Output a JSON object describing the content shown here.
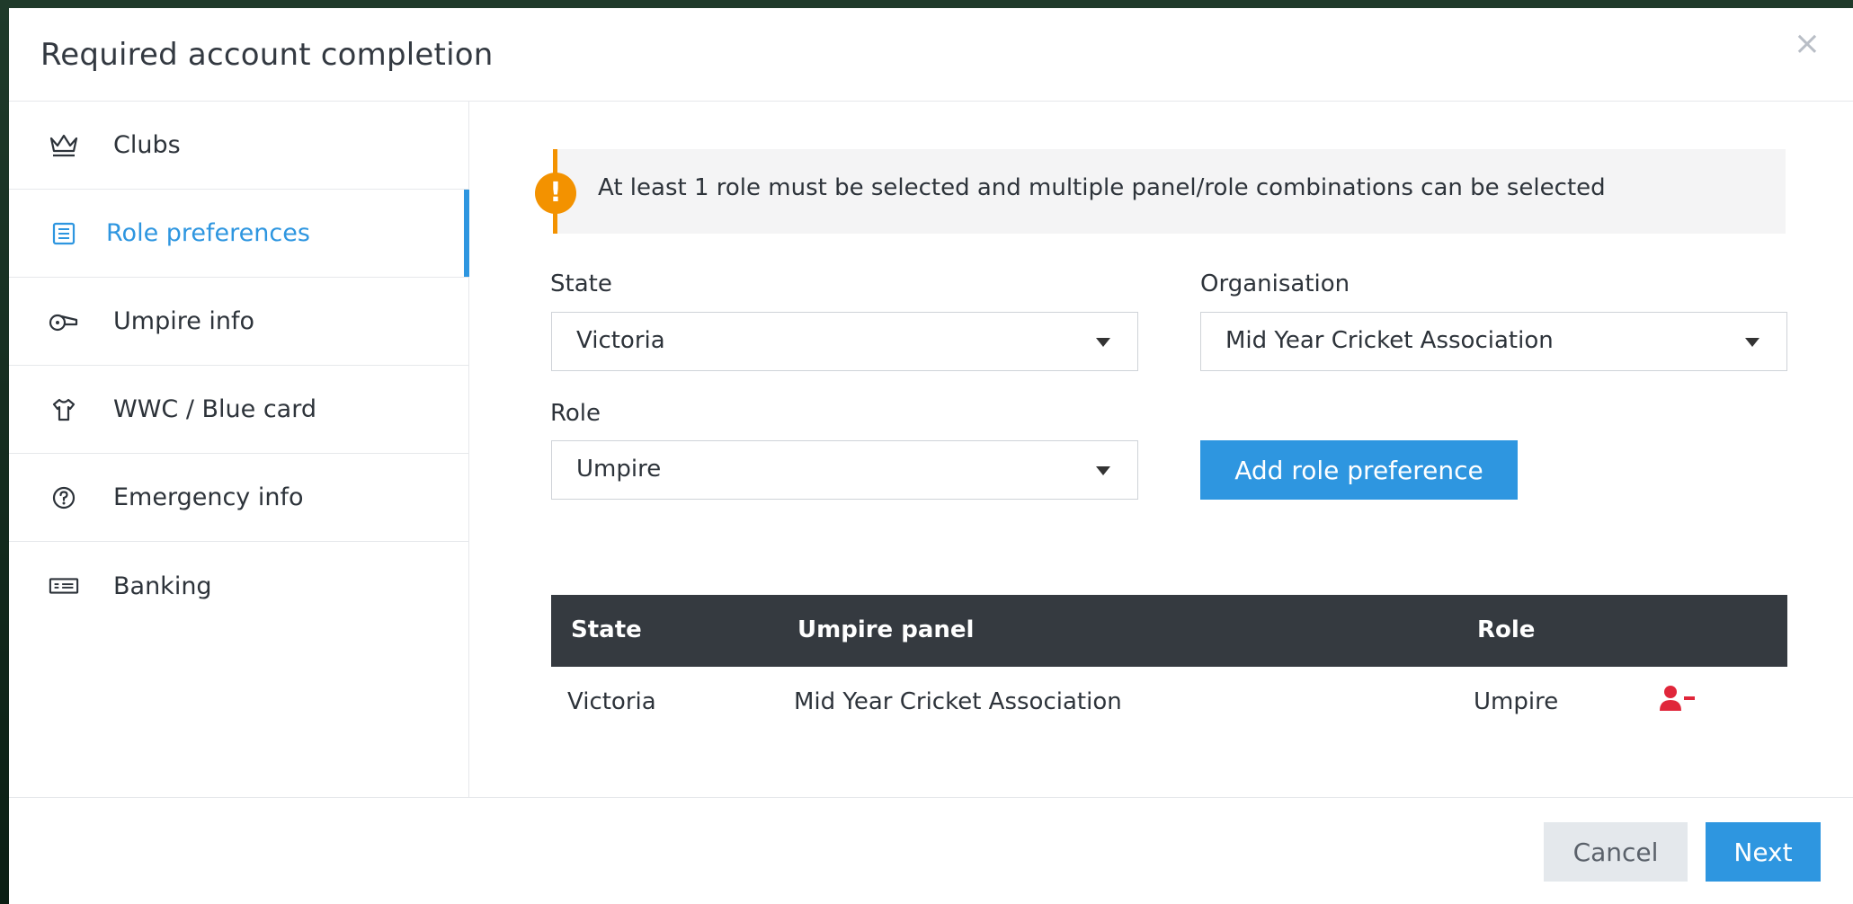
{
  "modal": {
    "title": "Required account completion",
    "close_symbol": "×"
  },
  "sidebar": {
    "items": [
      {
        "label": "Clubs",
        "icon": "crown-icon"
      },
      {
        "label": "Role preferences",
        "icon": "list-icon",
        "active": true
      },
      {
        "label": "Umpire info",
        "icon": "whistle-icon"
      },
      {
        "label": "WWC / Blue card",
        "icon": "shirt-icon"
      },
      {
        "label": "Emergency info",
        "icon": "question-circle-icon"
      },
      {
        "label": "Banking",
        "icon": "banknote-icon"
      }
    ]
  },
  "alert": {
    "icon": "!",
    "text": "At least 1 role must be selected and multiple panel/role combinations can be selected"
  },
  "form": {
    "state_label": "State",
    "state_value": "Victoria",
    "organisation_label": "Organisation",
    "organisation_value": "Mid Year Cricket Association",
    "role_label": "Role",
    "role_value": "Umpire",
    "add_button": "Add role preference"
  },
  "table": {
    "headers": [
      "State",
      "Umpire panel",
      "Role"
    ],
    "rows": [
      {
        "state": "Victoria",
        "panel": "Mid Year Cricket Association",
        "role": "Umpire"
      }
    ]
  },
  "footer": {
    "cancel_label": "Cancel",
    "next_label": "Next"
  },
  "colors": {
    "accent": "#2e96e0",
    "warning": "#f39200",
    "danger": "#e0263a",
    "table_header": "#353a40"
  }
}
